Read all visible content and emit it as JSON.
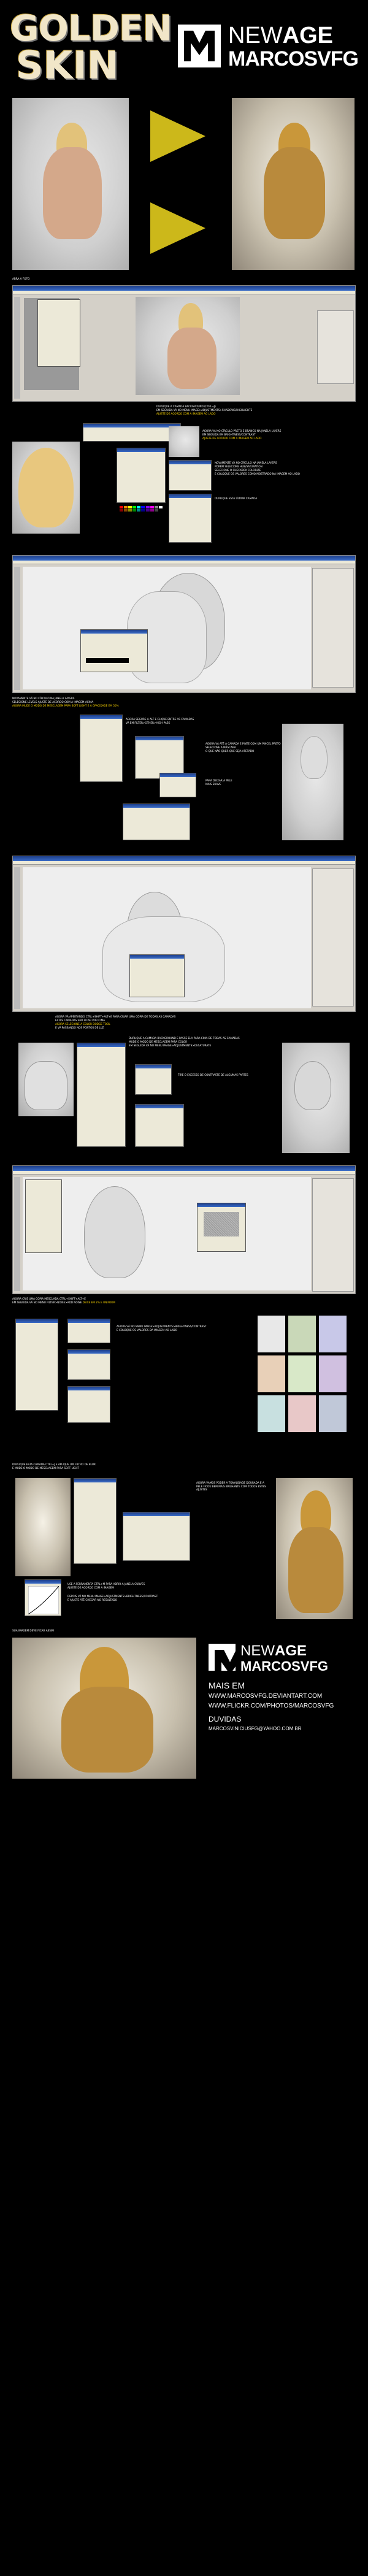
{
  "header": {
    "title_line1": "GOLDEN",
    "title_line2": "SKIN",
    "logo_letter": "M",
    "brand_new": "NEW",
    "brand_age": "AGE",
    "brand_name": "MARCOSVFG"
  },
  "steps": {
    "step1": "ABRA A FOTO",
    "step2a": "DUPLIQUE A CAMADA BACKGROUND (CTRL+J)",
    "step2b": "EM SEGUIDA VÁ NO MENU IMAGE>ADJUSTMENTS>SHADOWS/HIGHLIGHTS",
    "step2c": "AJUSTE DE ACORDO COM A IMAGEM AO LADO",
    "step3a": "AGORA VÁ NO CÍRCULO PRETO E BRANCO NA JANELA LAYERS",
    "step3b": "EM SEGUIDA EM BRIGHTNESS/CONTRAST",
    "step3c": "AJUSTE DE ACORDO COM A IMAGEM AO LADO",
    "step4a": "NOVAMENTE VÁ NO CÍRCULO NA JANELA LAYERS",
    "step4b": "PORÉM SELECIONE HUE/SATURATION",
    "step4c": "SELECIONE O CHECKBOX COLORIZE",
    "step4d": "E COLOQUE OS VALORES COMO MOSTRADO NA IMAGEM AO LADO",
    "step5": "DUPLIQUE ESTA ÚLTIMA CAMADA",
    "step6a": "NOVAMENTE VÁ NO CÍRCULO NA JANELA LAYERS",
    "step6b": "SELECIONE LEVELS AJUSTE DE ACORDO COM A IMAGEM ACIMA",
    "step6c": "AGORA MUDE O MODO DE MESCLAGEM PARA SOFT LIGHT E A OPACIDADE EM 50%",
    "step7a": "AGORA SEGURE A ALT E CLIQUE ENTRE AS CAMADAS",
    "step7b": "VÁ EM FILTER>OTHER>HIGH PASS",
    "step8a": "AGORA VÁ ATÉ A CAMADA E PINTE COM UM PINCEL PRETO",
    "step8b": "SELECIONE A MÁSCARA",
    "step8c": "O QUE NÃO QUER QUE SEJA AFETADO",
    "step8d": "PARA DEIXAR A PELE",
    "step8e": "MAIS SUAVE",
    "step9a": "AGORA VÁ APERTANDO CTRL+SHIFT+ALT+E PARA CRIAR UMA CÓPIA DE TODAS AS CAMADAS",
    "step9b": "ESTAS CAMADAS VÃO FICAR POR CIMA",
    "step9c": "AGORA SELECIONE A COLOR DODGE TOOL",
    "step9d": "E VÁ PASSANDO NOS PONTOS DE LUZ",
    "step10a": "DUPLIQUE A CAMADA BACKGROUND E PASSE ELA PARA CIMA DE TODAS AS CAMADAS",
    "step10b": "MUDE O MODO DE MESCLAGEM PARA COLOR",
    "step10c": "EM SEGUIDA VÁ NO MENU IMAGE>ADJUSTMENTS>DESATURATE",
    "step10d": "TIRE O EXCESSO DE CONTRASTE DE ALGUMAS PARTES",
    "step11a": "AGORA CRIE UMA COPIA MESCLADA CTRL+SHIFT+ALT+E",
    "step11b": "EM SEGUIDA VÁ NO MENU FILTER>NOISE>ADD NOISE",
    "step11c": "DEIXE EM 2% E UNIFORM",
    "step12a": "AGORA VÁ NO MENU IMAGE>ADJUSTMENTS>BRIGHTNESS/CONTRAST",
    "step12b": "E COLOQUE OS VALORES DA IMAGEM AO LADO",
    "step13a": "DUPLIQUE ESTA CAMADA CTRL+J E APLIQUE UM FILTRO DE BLUR",
    "step13b": "E MUDE O MODO DE MESCLAGEM PARA SOFT LIGHT",
    "step14a": "USE A FERRAMENTA CTRL+M PARA ABRIR A JANELA CURVES",
    "step14b": "AJUSTE DE ACORDO COM A IMAGEM",
    "step14c": "DEPOIS VÁ NO MENU IMAGE>ADJUSTMENTS>BRIGHTNESS/CONTRAST",
    "step14d": "E AJUSTE ATÉ CHEGAR NO RESULTADO",
    "step15": "AGORA VAMOS PODER A TONALIDADE DOURADA E A PELE FICOU BEM MAIS BRILHANTE COM TODOS ESTES AJUSTES",
    "step16": "SUA IMAGEM DEVE FICAR ASSIM"
  },
  "footer": {
    "logo_letter": "M",
    "brand_new": "NEW",
    "brand_age": "AGE",
    "brand_name": "MARCOSVFG",
    "mais_em": "MAIS EM",
    "link1": "WWW.MARCOSVFG.DEVIANTART.COM",
    "link2": "WWW.FLICKR.COM/PHOTOS/MARCOSVFG",
    "duvidas": "DUVIDAS",
    "email": "MARCOSVINICIUSFG@YAHOO.COM.BR"
  },
  "colors": {
    "background": "#000000",
    "accent_yellow": "#ccb81a",
    "highlight_text": "#ffd800",
    "title_cream": "#f1e6c8"
  }
}
